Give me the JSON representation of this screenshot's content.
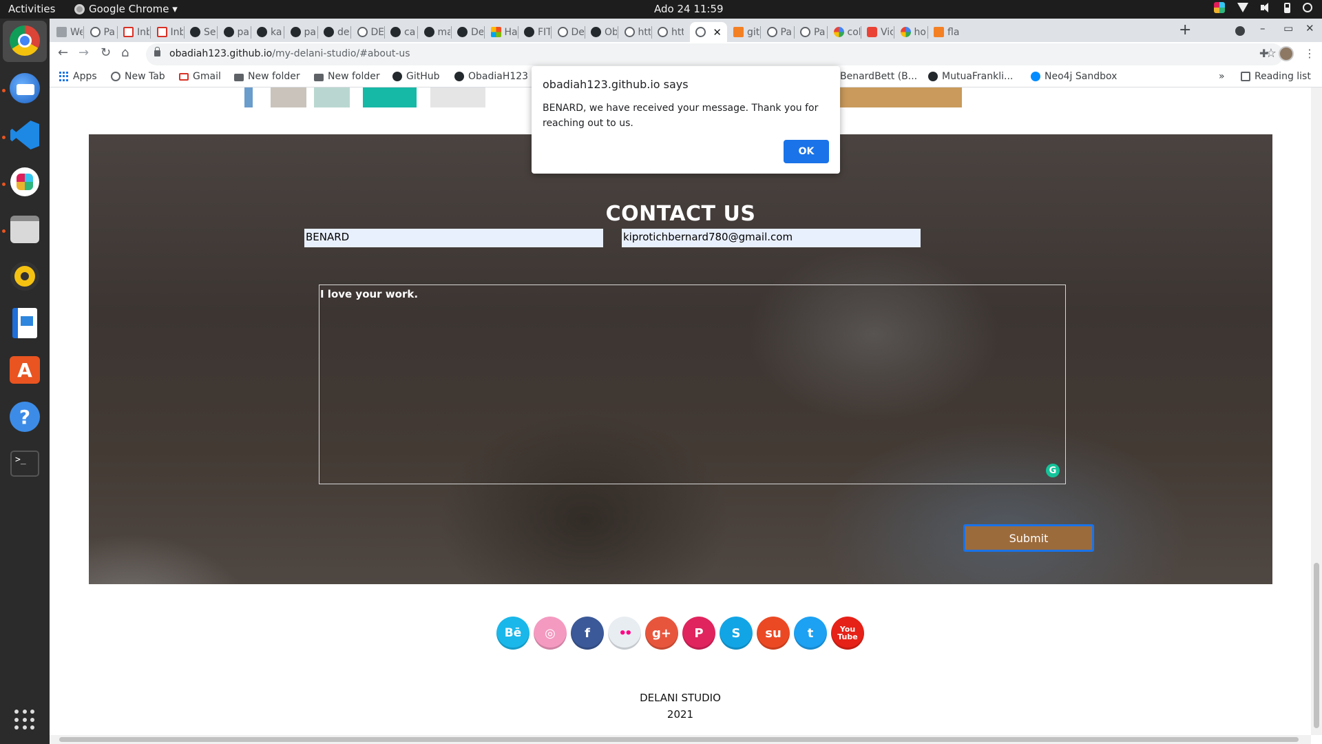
{
  "os": {
    "activities": "Activities",
    "app_menu": "Google Chrome ▾",
    "clock": "Ado 24  11:59"
  },
  "browser": {
    "tabs": [
      "We",
      "Pa",
      "Inb",
      "Inb",
      "Se",
      "pa",
      "ka",
      "pa",
      "de",
      "DE",
      "ca",
      "ma",
      "De",
      "Ha",
      "FIT",
      "De",
      "Ob",
      "htt",
      "htt",
      "",
      "git",
      "Pa",
      "Pa",
      "col",
      "Vic",
      "ho",
      "fla"
    ],
    "active_tab_close": "✕",
    "new_tab": "+",
    "url_host": "obadiah123.github.io",
    "url_path": "/my-delani-studio/#about-us"
  },
  "bookmarks": {
    "apps": "Apps",
    "new_tab": "New Tab",
    "gmail": "Gmail",
    "folder1": "New folder",
    "folder2": "New folder",
    "github": "GitHub",
    "obadiah": "ObadiaH123",
    "benard": "BenardBett (B...",
    "mutua": "MutuaFrankli...",
    "neo4j": "Neo4j Sandbox",
    "more": "»",
    "reading_list": "Reading list"
  },
  "alert": {
    "title": "obadiah123.github.io says",
    "message": "BENARD, we have received your message. Thank you for reaching out to us.",
    "ok": "OK"
  },
  "contact": {
    "heading": "CONTACT US",
    "name_value": "BENARD",
    "email_value": "kiprotichbernard780@gmail.com",
    "message_value": "I love your work.",
    "submit": "Submit"
  },
  "social": [
    {
      "icon": "behance-icon",
      "label": "Bē",
      "color": "#1ab7ea"
    },
    {
      "icon": "dribbble-icon",
      "label": "◎",
      "color": "#f49ac1"
    },
    {
      "icon": "facebook-icon",
      "label": "f",
      "color": "#3b5998"
    },
    {
      "icon": "flickr-icon",
      "label": "••",
      "color": "#e8edf2"
    },
    {
      "icon": "googleplus-icon",
      "label": "g+",
      "color": "#e8553d"
    },
    {
      "icon": "pinterest-icon",
      "label": "P",
      "color": "#e0245e"
    },
    {
      "icon": "skype-icon",
      "label": "S",
      "color": "#12a5e6"
    },
    {
      "icon": "stumbleupon-icon",
      "label": "su",
      "color": "#eb4924"
    },
    {
      "icon": "twitter-icon",
      "label": "t",
      "color": "#1da1f2"
    },
    {
      "icon": "youtube-icon",
      "label": "You Tube",
      "color": "#e62117"
    }
  ],
  "footer": {
    "brand": "DELANI STUDIO",
    "year": "2021"
  },
  "colors": {
    "submit_bg": "#9c6b3c",
    "ok_button": "#1a73e8",
    "input_bg": "#e9f0fd"
  }
}
